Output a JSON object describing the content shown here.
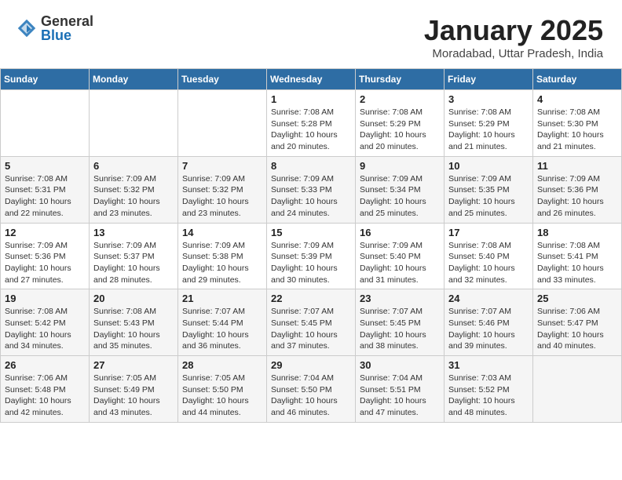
{
  "logo": {
    "general": "General",
    "blue": "Blue"
  },
  "header": {
    "month": "January 2025",
    "location": "Moradabad, Uttar Pradesh, India"
  },
  "weekdays": [
    "Sunday",
    "Monday",
    "Tuesday",
    "Wednesday",
    "Thursday",
    "Friday",
    "Saturday"
  ],
  "weeks": [
    [
      {
        "day": "",
        "info": ""
      },
      {
        "day": "",
        "info": ""
      },
      {
        "day": "",
        "info": ""
      },
      {
        "day": "1",
        "info": "Sunrise: 7:08 AM\nSunset: 5:28 PM\nDaylight: 10 hours\nand 20 minutes."
      },
      {
        "day": "2",
        "info": "Sunrise: 7:08 AM\nSunset: 5:29 PM\nDaylight: 10 hours\nand 20 minutes."
      },
      {
        "day": "3",
        "info": "Sunrise: 7:08 AM\nSunset: 5:29 PM\nDaylight: 10 hours\nand 21 minutes."
      },
      {
        "day": "4",
        "info": "Sunrise: 7:08 AM\nSunset: 5:30 PM\nDaylight: 10 hours\nand 21 minutes."
      }
    ],
    [
      {
        "day": "5",
        "info": "Sunrise: 7:08 AM\nSunset: 5:31 PM\nDaylight: 10 hours\nand 22 minutes."
      },
      {
        "day": "6",
        "info": "Sunrise: 7:09 AM\nSunset: 5:32 PM\nDaylight: 10 hours\nand 23 minutes."
      },
      {
        "day": "7",
        "info": "Sunrise: 7:09 AM\nSunset: 5:32 PM\nDaylight: 10 hours\nand 23 minutes."
      },
      {
        "day": "8",
        "info": "Sunrise: 7:09 AM\nSunset: 5:33 PM\nDaylight: 10 hours\nand 24 minutes."
      },
      {
        "day": "9",
        "info": "Sunrise: 7:09 AM\nSunset: 5:34 PM\nDaylight: 10 hours\nand 25 minutes."
      },
      {
        "day": "10",
        "info": "Sunrise: 7:09 AM\nSunset: 5:35 PM\nDaylight: 10 hours\nand 25 minutes."
      },
      {
        "day": "11",
        "info": "Sunrise: 7:09 AM\nSunset: 5:36 PM\nDaylight: 10 hours\nand 26 minutes."
      }
    ],
    [
      {
        "day": "12",
        "info": "Sunrise: 7:09 AM\nSunset: 5:36 PM\nDaylight: 10 hours\nand 27 minutes."
      },
      {
        "day": "13",
        "info": "Sunrise: 7:09 AM\nSunset: 5:37 PM\nDaylight: 10 hours\nand 28 minutes."
      },
      {
        "day": "14",
        "info": "Sunrise: 7:09 AM\nSunset: 5:38 PM\nDaylight: 10 hours\nand 29 minutes."
      },
      {
        "day": "15",
        "info": "Sunrise: 7:09 AM\nSunset: 5:39 PM\nDaylight: 10 hours\nand 30 minutes."
      },
      {
        "day": "16",
        "info": "Sunrise: 7:09 AM\nSunset: 5:40 PM\nDaylight: 10 hours\nand 31 minutes."
      },
      {
        "day": "17",
        "info": "Sunrise: 7:08 AM\nSunset: 5:40 PM\nDaylight: 10 hours\nand 32 minutes."
      },
      {
        "day": "18",
        "info": "Sunrise: 7:08 AM\nSunset: 5:41 PM\nDaylight: 10 hours\nand 33 minutes."
      }
    ],
    [
      {
        "day": "19",
        "info": "Sunrise: 7:08 AM\nSunset: 5:42 PM\nDaylight: 10 hours\nand 34 minutes."
      },
      {
        "day": "20",
        "info": "Sunrise: 7:08 AM\nSunset: 5:43 PM\nDaylight: 10 hours\nand 35 minutes."
      },
      {
        "day": "21",
        "info": "Sunrise: 7:07 AM\nSunset: 5:44 PM\nDaylight: 10 hours\nand 36 minutes."
      },
      {
        "day": "22",
        "info": "Sunrise: 7:07 AM\nSunset: 5:45 PM\nDaylight: 10 hours\nand 37 minutes."
      },
      {
        "day": "23",
        "info": "Sunrise: 7:07 AM\nSunset: 5:45 PM\nDaylight: 10 hours\nand 38 minutes."
      },
      {
        "day": "24",
        "info": "Sunrise: 7:07 AM\nSunset: 5:46 PM\nDaylight: 10 hours\nand 39 minutes."
      },
      {
        "day": "25",
        "info": "Sunrise: 7:06 AM\nSunset: 5:47 PM\nDaylight: 10 hours\nand 40 minutes."
      }
    ],
    [
      {
        "day": "26",
        "info": "Sunrise: 7:06 AM\nSunset: 5:48 PM\nDaylight: 10 hours\nand 42 minutes."
      },
      {
        "day": "27",
        "info": "Sunrise: 7:05 AM\nSunset: 5:49 PM\nDaylight: 10 hours\nand 43 minutes."
      },
      {
        "day": "28",
        "info": "Sunrise: 7:05 AM\nSunset: 5:50 PM\nDaylight: 10 hours\nand 44 minutes."
      },
      {
        "day": "29",
        "info": "Sunrise: 7:04 AM\nSunset: 5:50 PM\nDaylight: 10 hours\nand 46 minutes."
      },
      {
        "day": "30",
        "info": "Sunrise: 7:04 AM\nSunset: 5:51 PM\nDaylight: 10 hours\nand 47 minutes."
      },
      {
        "day": "31",
        "info": "Sunrise: 7:03 AM\nSunset: 5:52 PM\nDaylight: 10 hours\nand 48 minutes."
      },
      {
        "day": "",
        "info": ""
      }
    ]
  ]
}
